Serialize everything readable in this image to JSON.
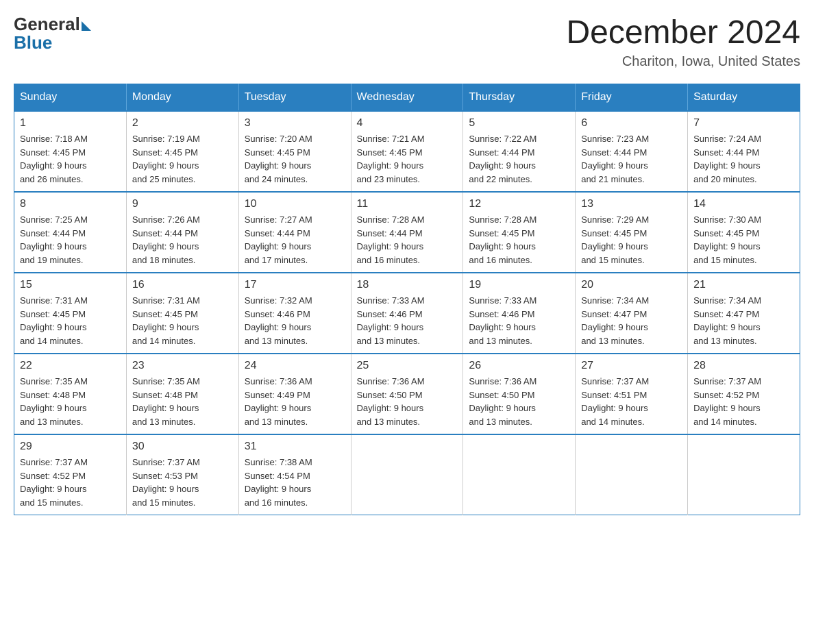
{
  "logo": {
    "general": "General",
    "blue": "Blue"
  },
  "header": {
    "title": "December 2024",
    "subtitle": "Chariton, Iowa, United States"
  },
  "days_of_week": [
    "Sunday",
    "Monday",
    "Tuesday",
    "Wednesday",
    "Thursday",
    "Friday",
    "Saturday"
  ],
  "weeks": [
    [
      {
        "day": "1",
        "sunrise": "7:18 AM",
        "sunset": "4:45 PM",
        "daylight": "9 hours and 26 minutes."
      },
      {
        "day": "2",
        "sunrise": "7:19 AM",
        "sunset": "4:45 PM",
        "daylight": "9 hours and 25 minutes."
      },
      {
        "day": "3",
        "sunrise": "7:20 AM",
        "sunset": "4:45 PM",
        "daylight": "9 hours and 24 minutes."
      },
      {
        "day": "4",
        "sunrise": "7:21 AM",
        "sunset": "4:45 PM",
        "daylight": "9 hours and 23 minutes."
      },
      {
        "day": "5",
        "sunrise": "7:22 AM",
        "sunset": "4:44 PM",
        "daylight": "9 hours and 22 minutes."
      },
      {
        "day": "6",
        "sunrise": "7:23 AM",
        "sunset": "4:44 PM",
        "daylight": "9 hours and 21 minutes."
      },
      {
        "day": "7",
        "sunrise": "7:24 AM",
        "sunset": "4:44 PM",
        "daylight": "9 hours and 20 minutes."
      }
    ],
    [
      {
        "day": "8",
        "sunrise": "7:25 AM",
        "sunset": "4:44 PM",
        "daylight": "9 hours and 19 minutes."
      },
      {
        "day": "9",
        "sunrise": "7:26 AM",
        "sunset": "4:44 PM",
        "daylight": "9 hours and 18 minutes."
      },
      {
        "day": "10",
        "sunrise": "7:27 AM",
        "sunset": "4:44 PM",
        "daylight": "9 hours and 17 minutes."
      },
      {
        "day": "11",
        "sunrise": "7:28 AM",
        "sunset": "4:44 PM",
        "daylight": "9 hours and 16 minutes."
      },
      {
        "day": "12",
        "sunrise": "7:28 AM",
        "sunset": "4:45 PM",
        "daylight": "9 hours and 16 minutes."
      },
      {
        "day": "13",
        "sunrise": "7:29 AM",
        "sunset": "4:45 PM",
        "daylight": "9 hours and 15 minutes."
      },
      {
        "day": "14",
        "sunrise": "7:30 AM",
        "sunset": "4:45 PM",
        "daylight": "9 hours and 15 minutes."
      }
    ],
    [
      {
        "day": "15",
        "sunrise": "7:31 AM",
        "sunset": "4:45 PM",
        "daylight": "9 hours and 14 minutes."
      },
      {
        "day": "16",
        "sunrise": "7:31 AM",
        "sunset": "4:45 PM",
        "daylight": "9 hours and 14 minutes."
      },
      {
        "day": "17",
        "sunrise": "7:32 AM",
        "sunset": "4:46 PM",
        "daylight": "9 hours and 13 minutes."
      },
      {
        "day": "18",
        "sunrise": "7:33 AM",
        "sunset": "4:46 PM",
        "daylight": "9 hours and 13 minutes."
      },
      {
        "day": "19",
        "sunrise": "7:33 AM",
        "sunset": "4:46 PM",
        "daylight": "9 hours and 13 minutes."
      },
      {
        "day": "20",
        "sunrise": "7:34 AM",
        "sunset": "4:47 PM",
        "daylight": "9 hours and 13 minutes."
      },
      {
        "day": "21",
        "sunrise": "7:34 AM",
        "sunset": "4:47 PM",
        "daylight": "9 hours and 13 minutes."
      }
    ],
    [
      {
        "day": "22",
        "sunrise": "7:35 AM",
        "sunset": "4:48 PM",
        "daylight": "9 hours and 13 minutes."
      },
      {
        "day": "23",
        "sunrise": "7:35 AM",
        "sunset": "4:48 PM",
        "daylight": "9 hours and 13 minutes."
      },
      {
        "day": "24",
        "sunrise": "7:36 AM",
        "sunset": "4:49 PM",
        "daylight": "9 hours and 13 minutes."
      },
      {
        "day": "25",
        "sunrise": "7:36 AM",
        "sunset": "4:50 PM",
        "daylight": "9 hours and 13 minutes."
      },
      {
        "day": "26",
        "sunrise": "7:36 AM",
        "sunset": "4:50 PM",
        "daylight": "9 hours and 13 minutes."
      },
      {
        "day": "27",
        "sunrise": "7:37 AM",
        "sunset": "4:51 PM",
        "daylight": "9 hours and 14 minutes."
      },
      {
        "day": "28",
        "sunrise": "7:37 AM",
        "sunset": "4:52 PM",
        "daylight": "9 hours and 14 minutes."
      }
    ],
    [
      {
        "day": "29",
        "sunrise": "7:37 AM",
        "sunset": "4:52 PM",
        "daylight": "9 hours and 15 minutes."
      },
      {
        "day": "30",
        "sunrise": "7:37 AM",
        "sunset": "4:53 PM",
        "daylight": "9 hours and 15 minutes."
      },
      {
        "day": "31",
        "sunrise": "7:38 AM",
        "sunset": "4:54 PM",
        "daylight": "9 hours and 16 minutes."
      },
      null,
      null,
      null,
      null
    ]
  ],
  "labels": {
    "sunrise": "Sunrise:",
    "sunset": "Sunset:",
    "daylight": "Daylight:"
  }
}
